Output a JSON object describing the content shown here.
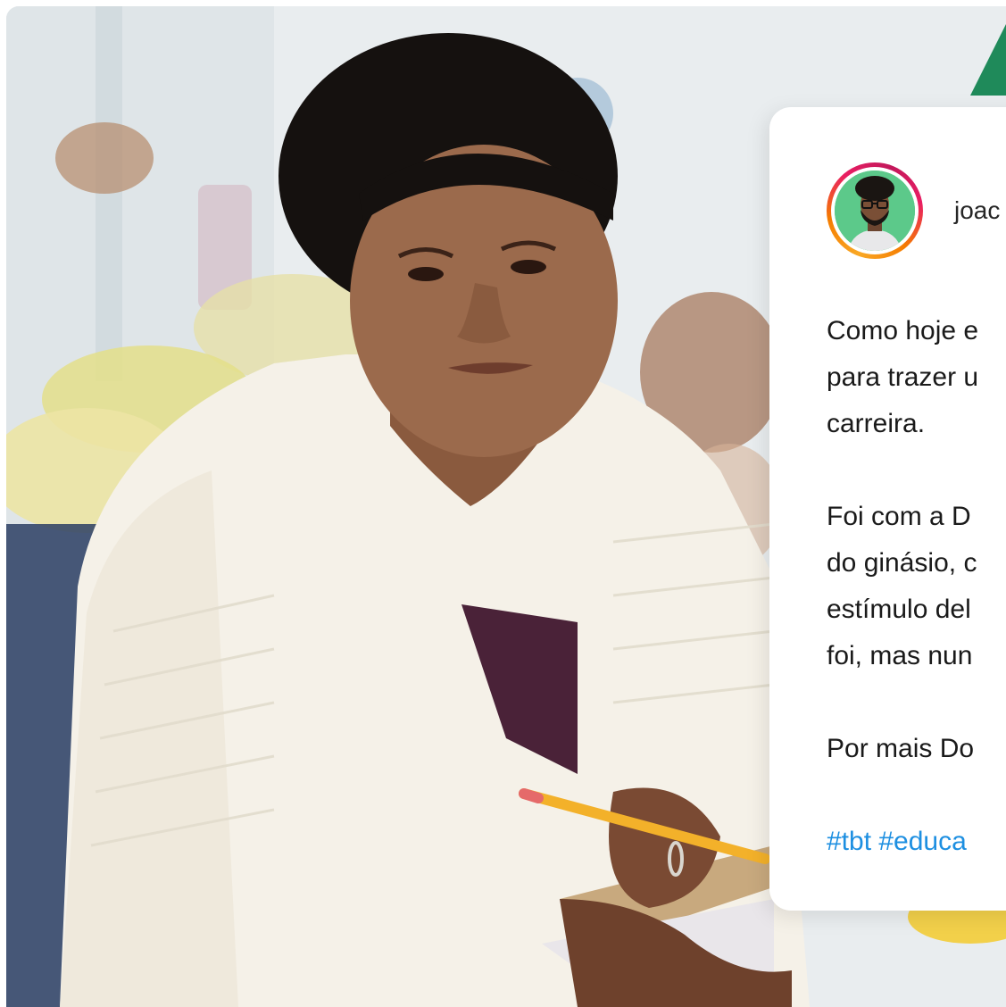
{
  "post": {
    "username": "joac",
    "paragraphs": [
      [
        "Como hoje e",
        "para trazer u",
        "carreira."
      ],
      [
        "Foi com a D",
        "do ginásio, c",
        "estímulo del",
        "foi, mas nun"
      ],
      [
        "Por mais Do"
      ]
    ],
    "hashtags": "#tbt #educa"
  },
  "colors": {
    "hashtag": "#1d8fe1",
    "avatar_bg": "#5cc98a",
    "ring_start": "#f9a825",
    "ring_end": "#e91e63"
  }
}
